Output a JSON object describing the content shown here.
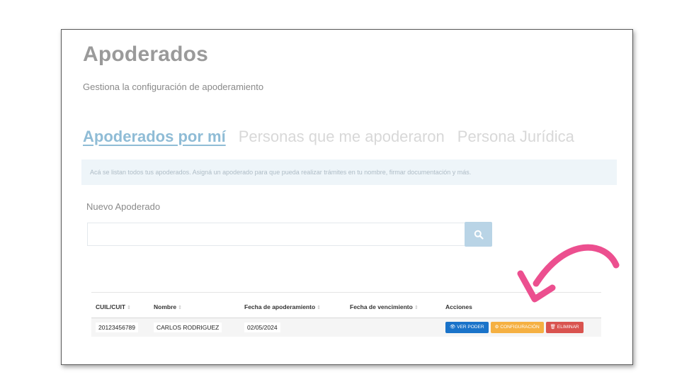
{
  "header": {
    "title": "Apoderados",
    "subtitle": "Gestiona la configuración de apoderamiento"
  },
  "tabs": [
    {
      "label": "Apoderados por mí",
      "active": true
    },
    {
      "label": "Personas que me apoderaron",
      "active": false
    },
    {
      "label": "Persona Jurídica",
      "active": false
    }
  ],
  "info_text": "Acá se listan todos tus apoderados. Asigná un apoderado para que pueda realizar trámites en tu nombre, firmar documentación y más.",
  "new_apoderado": {
    "label": "Nuevo Apoderado",
    "value": "",
    "placeholder": ""
  },
  "table": {
    "columns": [
      "CUIL/CUIT",
      "Nombre",
      "Fecha de apoderamiento",
      "Fecha de vencimiento",
      "Acciones"
    ],
    "rows": [
      {
        "cuil": "20123456789",
        "nombre": "CARLOS RODRIGUEZ",
        "fecha_apoderamiento": "02/05/2024",
        "fecha_vencimiento": ""
      }
    ],
    "actions": {
      "ver": "VER PODER",
      "config": "CONFIGURACIÓN",
      "eliminar": "ELIMINAR"
    }
  },
  "colors": {
    "active_tab": "#8fbcd6",
    "search_button": "#b9d4e6",
    "btn_ver": "#1a73c9",
    "btn_config": "#f5b042",
    "btn_eliminar": "#d9534f",
    "annotation_arrow": "#ec4f8f"
  },
  "icons": {
    "search": "search-icon",
    "ver": "eye-icon",
    "config": "gear-icon",
    "eliminar": "trash-icon",
    "annotation": "curved-arrow-icon"
  }
}
